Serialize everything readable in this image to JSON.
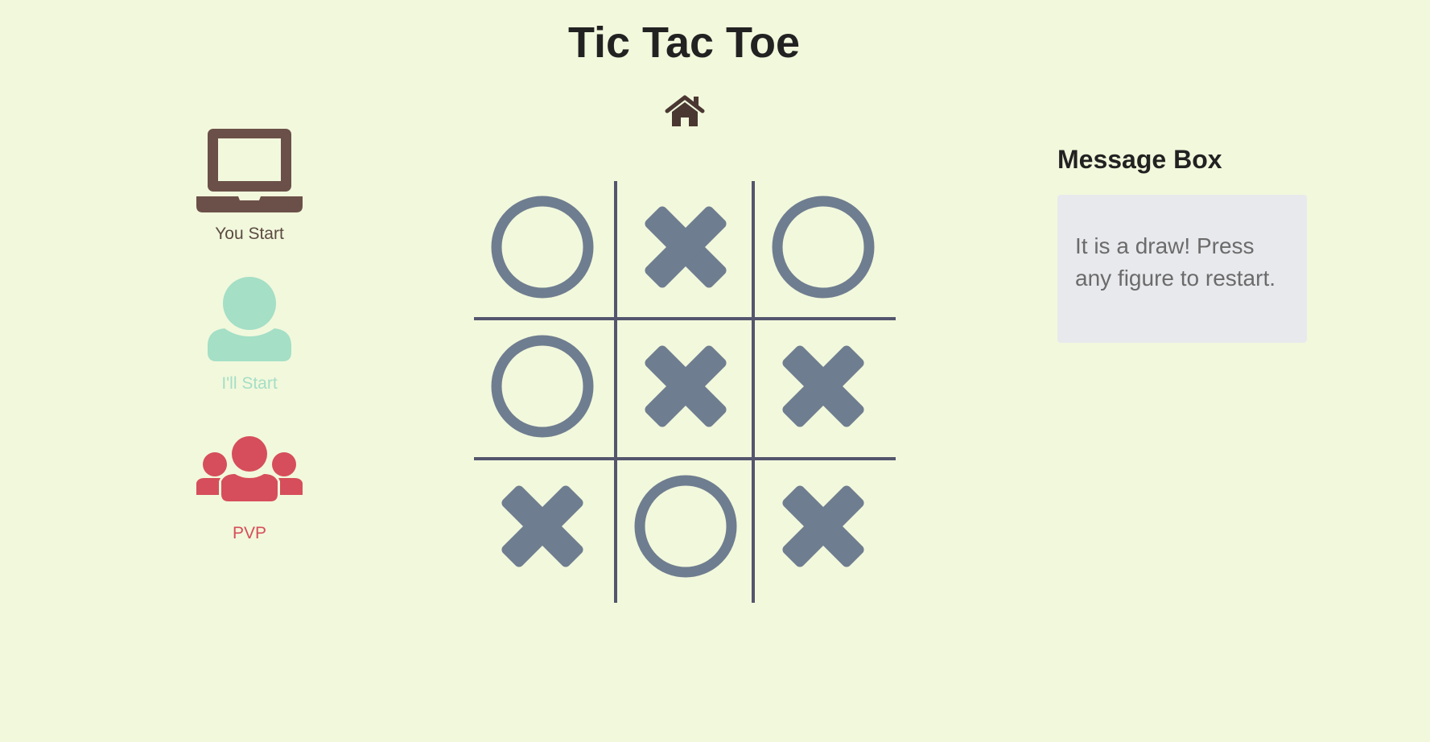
{
  "title": "Tic Tac Toe",
  "home_icon": "home-icon",
  "modes": [
    {
      "label": "You Start",
      "icon": "laptop-icon",
      "color": "#6b5049"
    },
    {
      "label": "I'll Start",
      "icon": "user-icon",
      "color": "#a4dfc6"
    },
    {
      "label": "PVP",
      "icon": "users-icon",
      "color": "#d64e5b"
    }
  ],
  "board": [
    [
      "O",
      "X",
      "O"
    ],
    [
      "O",
      "X",
      "X"
    ],
    [
      "X",
      "O",
      "X"
    ]
  ],
  "colors": {
    "background": "#f2f8dc",
    "grid": "#54566e",
    "mark": "#6f7d90",
    "message_bg": "#e8e9ed"
  },
  "message": {
    "heading": "Message Box",
    "text": "It is a draw! Press any figure to restart."
  }
}
